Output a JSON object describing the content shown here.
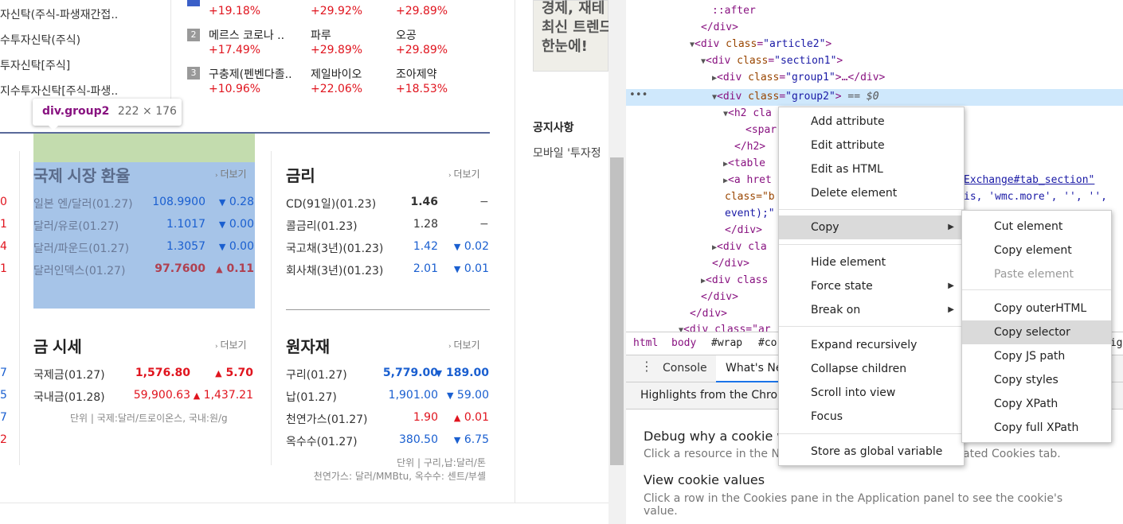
{
  "left_funds": [
    "자신탁(주식-파생재간접..",
    "수투자신탁(주식)",
    "투자신탁[주식]",
    "지수투자신탁[주식-파생.."
  ],
  "rank_rows": [
    {
      "rank": "",
      "c1": {
        "name": "",
        "pct": "+19.18%"
      },
      "c2": {
        "name": "",
        "pct": "+29.92%"
      },
      "c3": {
        "name": "",
        "pct": "+29.89%"
      }
    },
    {
      "rank": "2",
      "c1": {
        "name": "메르스 코로나 ..",
        "pct": "+17.49%"
      },
      "c2": {
        "name": "파루",
        "pct": "+29.89%"
      },
      "c3": {
        "name": "오공",
        "pct": "+29.89%"
      }
    },
    {
      "rank": "3",
      "c1": {
        "name": "구충제(펜벤다졸..",
        "pct": "+10.96%"
      },
      "c2": {
        "name": "제일바이오",
        "pct": "+22.06%"
      },
      "c3": {
        "name": "조아제약",
        "pct": "+18.53%"
      }
    }
  ],
  "tooltip": {
    "tag": "div.group2",
    "size": "222 × 176"
  },
  "right_panel": {
    "notice_title": "공지사항",
    "notice_item": "모바일 '투자정",
    "ad_lines": [
      "경제, 재테",
      "최신 트렌드",
      "한눈에!"
    ]
  },
  "exchange": {
    "title": "국제 시장 환율",
    "more": "더보기",
    "rows": [
      {
        "name": "일본 엔/달러(01.27)",
        "value": "108.9900",
        "dir": "▼",
        "change": "0.28",
        "color": "#1a5fd0"
      },
      {
        "name": "달러/유로(01.27)",
        "value": "1.1017",
        "dir": "▼",
        "change": "0.00",
        "color": "#1a5fd0"
      },
      {
        "name": "달러/파운드(01.27)",
        "value": "1.3057",
        "dir": "▼",
        "change": "0.00",
        "color": "#1a5fd0"
      },
      {
        "name": "달러인덱스(01.27)",
        "value": "97.7600",
        "dir": "▲",
        "change": "0.11",
        "color": "#e0141e"
      }
    ]
  },
  "rates": {
    "title": "금리",
    "more": "더보기",
    "rows": [
      {
        "name": "CD(91일)(01.23)",
        "value": "1.46",
        "dir": "",
        "change": "−",
        "color": "#222"
      },
      {
        "name": "콜금리(01.23)",
        "value": "1.28",
        "dir": "",
        "change": "−",
        "color": "#222"
      },
      {
        "name": "국고채(3년)(01.23)",
        "value": "1.42",
        "dir": "▼",
        "change": "0.02",
        "color": "#1a5fd0"
      },
      {
        "name": "회사채(3년)(01.23)",
        "value": "2.01",
        "dir": "▼",
        "change": "0.01",
        "color": "#1a5fd0"
      }
    ]
  },
  "gold": {
    "title": "금 시세",
    "more": "더보기",
    "rows": [
      {
        "name": "국제금(01.27)",
        "value": "1,576.80",
        "dir": "▲",
        "change": "5.70",
        "color": "#e0141e"
      },
      {
        "name": "국내금(01.28)",
        "value": "59,900.63",
        "dir": "▲",
        "change": "1,437.21",
        "color": "#e0141e"
      }
    ],
    "unit": "단위 | 국제:달러/트로이온스, 국내:원/g"
  },
  "raw": {
    "title": "원자재",
    "more": "더보기",
    "rows": [
      {
        "name": "구리(01.27)",
        "value": "5,779.00",
        "dir": "▼",
        "change": "189.00",
        "color": "#1a5fd0"
      },
      {
        "name": "납(01.27)",
        "value": "1,901.00",
        "dir": "▼",
        "change": "59.00",
        "color": "#1a5fd0"
      },
      {
        "name": "천연가스(01.27)",
        "value": "1.90",
        "dir": "▲",
        "change": "0.01",
        "color": "#e0141e"
      },
      {
        "name": "옥수수(01.27)",
        "value": "380.50",
        "dir": "▼",
        "change": "6.75",
        "color": "#1a5fd0"
      }
    ],
    "unit1": "단위 | 구리,납:달러/톤",
    "unit2": "천연가스: 달러/MMBtu, 옥수수: 센트/부셸"
  },
  "left_edge_nums": [
    "0",
    "1",
    "4",
    "1",
    "7",
    "5",
    "7",
    "2"
  ],
  "devtools": {
    "lines": [
      {
        "indent": 8,
        "text": "::after",
        "kind": "pseudo"
      },
      {
        "indent": 7,
        "text": "</div>",
        "kind": "close"
      },
      {
        "indent": 6,
        "tri": "▼",
        "tag": "div",
        "attr": "class",
        "val": "article2"
      },
      {
        "indent": 7,
        "tri": "▼",
        "tag": "div",
        "attr": "class",
        "val": "section1"
      },
      {
        "indent": 8,
        "tri": "▶",
        "tag": "div",
        "attr": "class",
        "val": "group1",
        "tail": "…</div>"
      },
      {
        "indent": 8,
        "tri": "▼",
        "tag": "div",
        "attr": "class",
        "val": "group2",
        "tail": " == $0",
        "selected": true
      },
      {
        "indent": 9,
        "tri": "▼",
        "text": "<h2 cla"
      },
      {
        "indent": 10,
        "text": "<spar"
      },
      {
        "indent": 9,
        "text": "</h2>",
        "kind": "close"
      },
      {
        "indent": 9,
        "tri": "▶",
        "text": "<table"
      },
      {
        "indent": 9,
        "tri": "▶",
        "text": "<a hret"
      },
      {
        "indent": 9,
        "text": "class=\"b"
      },
      {
        "indent": 9,
        "text": "event);\""
      },
      {
        "indent": 9,
        "text": "</div>",
        "kind": "close"
      },
      {
        "indent": 8,
        "tri": "▶",
        "text": "<div cla"
      },
      {
        "indent": 8,
        "text": "</div>",
        "kind": "close"
      },
      {
        "indent": 7,
        "tri": "▶",
        "text": "<div class"
      },
      {
        "indent": 7,
        "text": "</div>",
        "kind": "close"
      },
      {
        "indent": 6,
        "text": "</div>",
        "kind": "close"
      },
      {
        "indent": 6,
        "tri": "▼",
        "text": "<div class=\"ar"
      }
    ],
    "link_fragment": "Exchange#tab_section\"",
    "onclick_fragment": "is, 'wmc.more', '', '',",
    "breadcrumbs": [
      "html",
      "body",
      "#wrap",
      "#co",
      "eig"
    ],
    "tabs": {
      "console": "Console",
      "whatsnew": "What's Ne"
    },
    "highlights": "Highlights from the Chron",
    "cookie1_title": "Debug why a cookie w",
    "cookie1_desc_a": "Click a resource in the N",
    "cookie1_desc_b": "ated Cookies tab.",
    "cookie2_title": "View cookie values",
    "cookie2_desc": "Click a row in the Cookies pane in the Application panel to see the cookie's value."
  },
  "context_menu": {
    "items": [
      "Add attribute",
      "Edit attribute",
      "Edit as HTML",
      "Delete element",
      "Copy",
      "Hide element",
      "Force state",
      "Break on",
      "Expand recursively",
      "Collapse children",
      "Scroll into view",
      "Focus",
      "Store as global variable"
    ]
  },
  "copy_submenu": {
    "items": [
      "Cut element",
      "Copy element",
      "Paste element",
      "Copy outerHTML",
      "Copy selector",
      "Copy JS path",
      "Copy styles",
      "Copy XPath",
      "Copy full XPath"
    ]
  }
}
